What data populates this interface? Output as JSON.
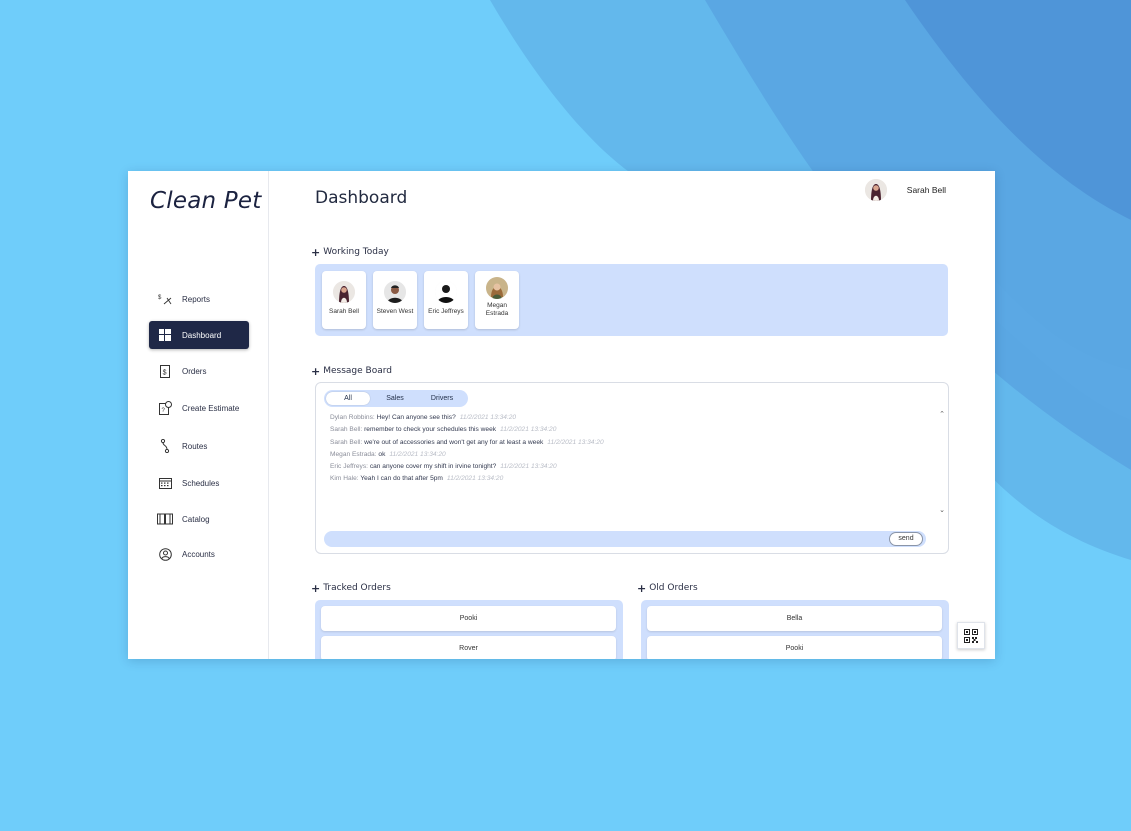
{
  "app": {
    "logo": "Clean Pet"
  },
  "sidebar": {
    "items": [
      {
        "label": "Reports",
        "icon": "reports-icon",
        "active": false
      },
      {
        "label": "Dashboard",
        "icon": "dashboard-icon",
        "active": true
      },
      {
        "label": "Orders",
        "icon": "orders-icon",
        "active": false
      },
      {
        "label": "Create Estimate",
        "icon": "estimate-icon",
        "active": false
      },
      {
        "label": "Routes",
        "icon": "routes-icon",
        "active": false
      },
      {
        "label": "Schedules",
        "icon": "calendar-icon",
        "active": false
      },
      {
        "label": "Catalog",
        "icon": "catalog-icon",
        "active": false
      },
      {
        "label": "Accounts",
        "icon": "account-icon",
        "active": false
      }
    ]
  },
  "header": {
    "title": "Dashboard",
    "user_name": "Sarah Bell"
  },
  "working_today": {
    "heading": "Working Today",
    "people": [
      {
        "name": "Sarah Bell"
      },
      {
        "name": "Steven West"
      },
      {
        "name": "Eric Jeffreys"
      },
      {
        "name": "Megan Estrada"
      }
    ]
  },
  "message_board": {
    "heading": "Message Board",
    "filters": [
      "All",
      "Sales",
      "Drivers"
    ],
    "selected_filter": "All",
    "messages": [
      {
        "author": "Dylan Robbins:",
        "text": "Hey! Can anyone see this?",
        "time": "11/2/2021 13:34:20"
      },
      {
        "author": "Sarah Bell:",
        "text": "remember to check your schedules this week",
        "time": "11/2/2021 13:34:20"
      },
      {
        "author": "Sarah Bell:",
        "text": "we're out of accessories and won't get any for at least a week",
        "time": "11/2/2021 13:34:20"
      },
      {
        "author": "Megan Estrada:",
        "text": "ok",
        "time": "11/2/2021 13:34:20"
      },
      {
        "author": "Eric Jeffreys:",
        "text": "can anyone cover my shift in irvine tonight?",
        "time": "11/2/2021 13:34:20"
      },
      {
        "author": "Kim Hale:",
        "text": "Yeah I can do that after 5pm",
        "time": "11/2/2021 13:34:20"
      }
    ],
    "input_value": "",
    "send_label": "send"
  },
  "tracked_orders": {
    "heading": "Tracked Orders",
    "items": [
      "Pooki",
      "Rover"
    ]
  },
  "old_orders": {
    "heading": "Old Orders",
    "items": [
      "Bella",
      "Pooki"
    ]
  },
  "colors": {
    "accent_light": "#cfdffd",
    "nav_active": "#1f2847",
    "background": "#6dcdfa"
  }
}
